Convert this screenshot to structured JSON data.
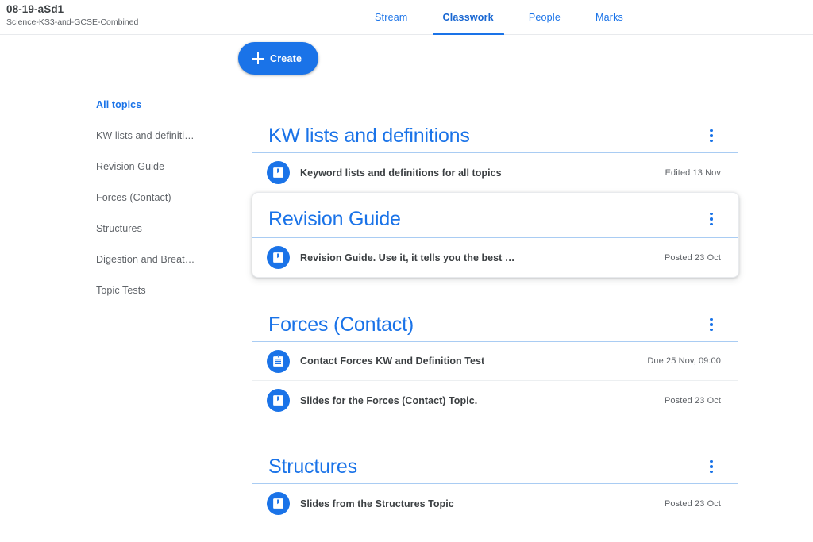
{
  "header": {
    "class_name": "08-19-aSd1",
    "class_section": "Science-KS3-and-GCSE-Combined",
    "tabs": [
      {
        "label": "Stream",
        "active": false
      },
      {
        "label": "Classwork",
        "active": true
      },
      {
        "label": "People",
        "active": false
      },
      {
        "label": "Marks",
        "active": false
      }
    ]
  },
  "sidebar": {
    "items": [
      {
        "label": "All topics",
        "active": true
      },
      {
        "label": "KW lists and definiti…",
        "active": false
      },
      {
        "label": "Revision Guide",
        "active": false
      },
      {
        "label": "Forces (Contact)",
        "active": false
      },
      {
        "label": "Structures",
        "active": false
      },
      {
        "label": "Digestion and Breat…",
        "active": false
      },
      {
        "label": "Topic Tests",
        "active": false
      }
    ]
  },
  "toolbar": {
    "create_label": "Create",
    "create_icon": "plus-icon"
  },
  "topics": [
    {
      "title": "KW lists and definitions",
      "menu_icon": "more-vert-icon",
      "elevated": false,
      "items": [
        {
          "title": "Keyword lists and definitions for all topics",
          "meta": "Edited 13 Nov",
          "icon": "material-icon"
        }
      ]
    },
    {
      "title": "Revision Guide",
      "menu_icon": "more-vert-icon",
      "elevated": true,
      "items": [
        {
          "title": "Revision Guide. Use it, it tells you the best …",
          "meta": "Posted 23 Oct",
          "icon": "material-icon"
        }
      ]
    },
    {
      "title": "Forces (Contact)",
      "menu_icon": "more-vert-icon",
      "elevated": false,
      "items": [
        {
          "title": "Contact Forces KW and Definition Test",
          "meta": "Due 25 Nov, 09:00",
          "icon": "assignment-icon"
        },
        {
          "title": "Slides for the Forces (Contact) Topic.",
          "meta": "Posted 23 Oct",
          "icon": "material-icon"
        }
      ]
    },
    {
      "title": "Structures",
      "menu_icon": "more-vert-icon",
      "elevated": false,
      "items": [
        {
          "title": "Slides from the Structures Topic",
          "meta": "Posted 23 Oct",
          "icon": "material-icon"
        }
      ]
    }
  ],
  "colors": {
    "google_blue": "#1a73e8",
    "active_blue": "#1967d2",
    "text_primary": "#3c4043",
    "text_secondary": "#5f6368",
    "divider_blue": "#a9ccf3",
    "divider_gray": "#eceff1"
  }
}
